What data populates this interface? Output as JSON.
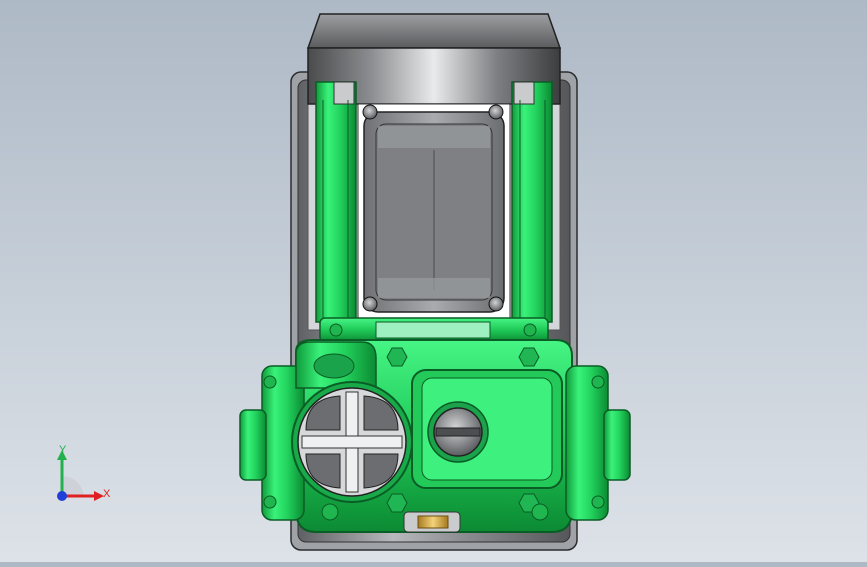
{
  "viewport": {
    "background_top": "#aeb9c6",
    "background_bottom": "#dde2e8"
  },
  "model": {
    "body_color": "#2ee86a",
    "body_dark": "#0f9a3a",
    "metal_color": "#8d9096",
    "cap_color": "#5a5c5f"
  },
  "triad": {
    "x_label": "X",
    "y_label": "Y",
    "x_color": "#e02020",
    "y_color": "#22b14c",
    "z_color": "#1f3fd8"
  }
}
